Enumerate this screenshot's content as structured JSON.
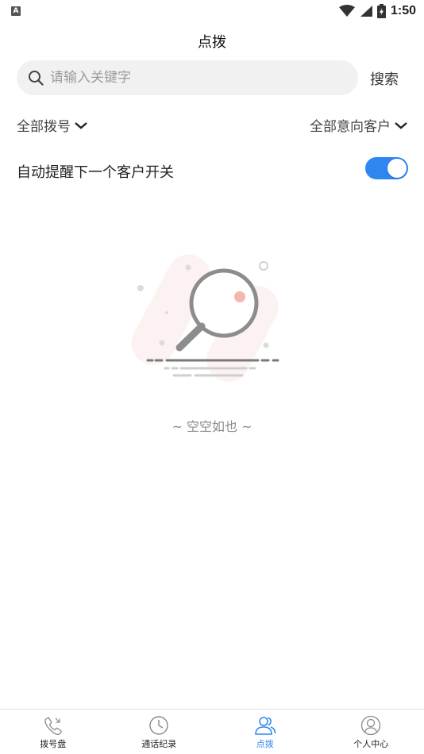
{
  "status_bar": {
    "time": "1:50",
    "left_badge": "A"
  },
  "header": {
    "title": "点拨"
  },
  "search": {
    "placeholder": "请输入关键字",
    "button_label": "搜索"
  },
  "filters": {
    "left_label": "全部拨号",
    "right_label": "全部意向客户"
  },
  "auto_remind": {
    "label": "自动提醒下一个客户开关",
    "enabled": true
  },
  "empty_state": {
    "text": "~ 空空如也 ~"
  },
  "tabbar": {
    "active_index": 2,
    "active_color": "#2e86f0",
    "items": [
      {
        "label": "拨号盘",
        "icon": "phone-icon"
      },
      {
        "label": "通话纪录",
        "icon": "clock-icon"
      },
      {
        "label": "点拨",
        "icon": "users-icon"
      },
      {
        "label": "个人中心",
        "icon": "user-icon"
      }
    ]
  }
}
